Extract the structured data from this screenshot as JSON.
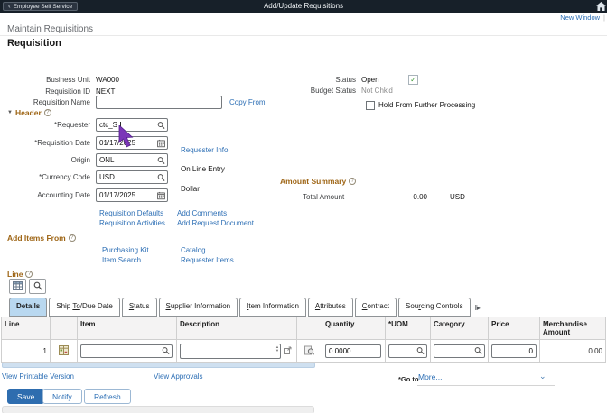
{
  "icons": {
    "back_chevron": "‹",
    "pipe": "|",
    "collapse_triangle": "▼",
    "help": "?",
    "check": "✓",
    "dropdown_chevron": "⌄",
    "tab_overflow": "‖▸",
    "spinner_up": "▲",
    "spinner_down": "▼"
  },
  "topbar": {
    "back_label": "Employee Self Service",
    "title": "Add/Update Requisitions"
  },
  "page": {
    "new_window": "New Window",
    "breadcrumb": "Maintain Requisitions",
    "title": "Requisition"
  },
  "req_info": {
    "business_unit_label": "Business Unit",
    "business_unit": "WA000",
    "requisition_id_label": "Requisition ID",
    "requisition_id": "NEXT",
    "requisition_name_label": "Requisition Name",
    "requisition_name": "",
    "copy_from": "Copy From",
    "status_label": "Status",
    "status": "Open",
    "budget_status_label": "Budget Status",
    "budget_status": "Not Chk'd",
    "hold_label": "Hold From Further Processing"
  },
  "header_section": {
    "title": "Header",
    "requester_label": "*Requester",
    "requester": "ctc_S",
    "requisition_date_label": "*Requisition Date",
    "requisition_date": "01/17/2025",
    "requester_info_link": "Requester Info",
    "origin_label": "Origin",
    "origin": "ONL",
    "origin_desc": "On Line Entry",
    "currency_label": "*Currency Code",
    "currency": "USD",
    "currency_desc": "Dollar",
    "accounting_date_label": "Accounting Date",
    "accounting_date": "01/17/2025",
    "links": {
      "defaults": "Requisition Defaults",
      "activities": "Requisition Activities",
      "comments": "Add Comments",
      "request_document": "Add Request Document"
    }
  },
  "amount_summary": {
    "title": "Amount Summary",
    "total_label": "Total Amount",
    "total": "0.00",
    "currency": "USD"
  },
  "add_items_from": {
    "title": "Add Items From",
    "purchasing_kit": "Purchasing Kit",
    "item_search": "Item Search",
    "catalog": "Catalog",
    "requester_items": "Requester Items"
  },
  "line": {
    "title": "Line",
    "tabs": [
      {
        "label": "Details",
        "key": ""
      },
      {
        "label": "Ship To/Due Date",
        "key": "To"
      },
      {
        "label": "Status",
        "key": "S"
      },
      {
        "label": "Supplier Information",
        "key": "S"
      },
      {
        "label": "Item Information",
        "key": "I"
      },
      {
        "label": "Attributes",
        "key": "A"
      },
      {
        "label": "Contract",
        "key": "C"
      },
      {
        "label": "Sourcing Controls",
        "key": "r"
      }
    ],
    "columns": [
      "Line",
      "Item",
      "Description",
      "Quantity",
      "*UOM",
      "Category",
      "Price",
      "Merchandise Amount"
    ],
    "row": {
      "line": "1",
      "item": "",
      "description": "",
      "quantity": "0.0000",
      "uom": "",
      "category": "",
      "price": "0",
      "merchandise_amount": "0.00"
    }
  },
  "footer": {
    "view_printable": "View Printable Version",
    "view_approvals": "View Approvals",
    "goto_label": "*Go to",
    "goto_value": "More...",
    "save": "Save",
    "notify": "Notify",
    "refresh": "Refresh"
  },
  "colors": {
    "topbar_bg": "#172029",
    "link_blue": "#2d6fb5",
    "section_brown": "#9e6515",
    "active_tab": "#b9d8f0",
    "primary_button": "#2e6daf",
    "status_check_green": "#3d9b35"
  }
}
